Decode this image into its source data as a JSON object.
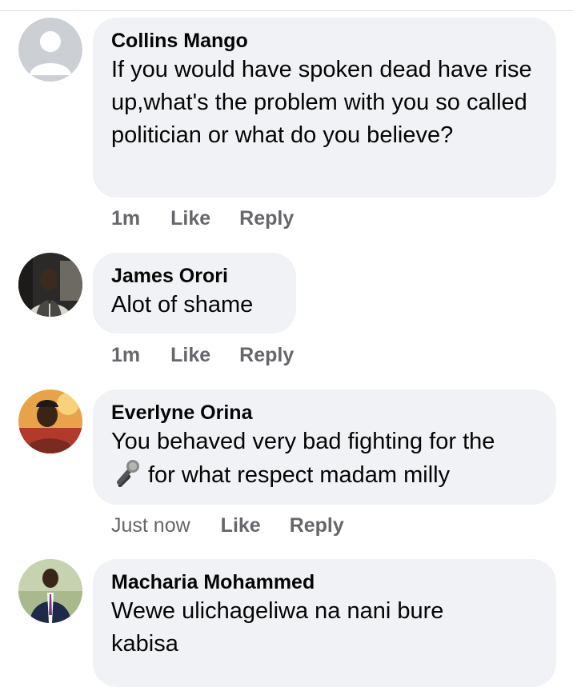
{
  "comments": [
    {
      "author": "Collins Mango",
      "text": "If you would have spoken dead have rise up,what's the problem with you so called politician or what do you believe?",
      "time": "1m",
      "like_label": "Like",
      "reply_label": "Reply",
      "avatar_icon": "default-profile-silhouette"
    },
    {
      "author": "James Orori",
      "text": "Alot of shame",
      "time": "1m",
      "like_label": "Like",
      "reply_label": "Reply",
      "avatar_icon": "profile-photo-man-in-suit"
    },
    {
      "author": "Everlyne Orina",
      "text_emoji": "microphone-emoji",
      "text_line1": "You behaved very bad fighting for the",
      "text_line2": "for what respect madam milly",
      "time": "Just now",
      "like_label": "Like",
      "reply_label": "Reply",
      "avatar_icon": "profile-photo-woman"
    },
    {
      "author": "Macharia Mohammed",
      "text": "Wewe ulichageliwa na nani bure kabisa",
      "avatar_icon": "profile-photo-man-in-suit-outdoors"
    }
  ],
  "colors": {
    "bubble_bg": "#f0f2f5",
    "meta_text": "#65676b",
    "primary_text": "#050505"
  }
}
